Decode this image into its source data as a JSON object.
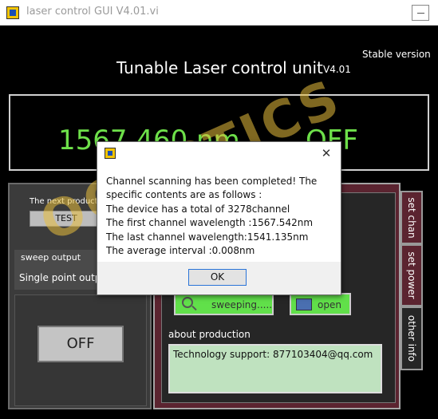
{
  "window": {
    "title": "laser control GUI V4.01.vi"
  },
  "header": {
    "title": "Tunable Laser control unit",
    "version": "V4.01",
    "stable_label": "Stable version"
  },
  "display": {
    "wavelength": "1567.460 nm",
    "laser_state": "OFF"
  },
  "left_panel": {
    "next_product_label": "The next product:",
    "test_button": "TEST",
    "sweep_tab": "sweep output",
    "single_tab": "Single point output",
    "off_button": "OFF"
  },
  "right_panel": {
    "sweep_button": "sweeping.....",
    "open_button": "open",
    "about_label": "about production",
    "support_text": "Technology support:  877103404@qq.com"
  },
  "tabs": [
    "set chan",
    "set power",
    "other info"
  ],
  "watermark": "OOOPTICS",
  "dialog": {
    "lines": [
      "Channel scanning has been completed! The",
      "specific contents are as follows :",
      "The device has a total of 3278channel",
      "The first channel wavelength :1567.542nm",
      "The last channel wavelength:1541.135nm",
      "The average interval :0.008nm"
    ],
    "ok_button": "OK",
    "close_glyph": "✕"
  }
}
